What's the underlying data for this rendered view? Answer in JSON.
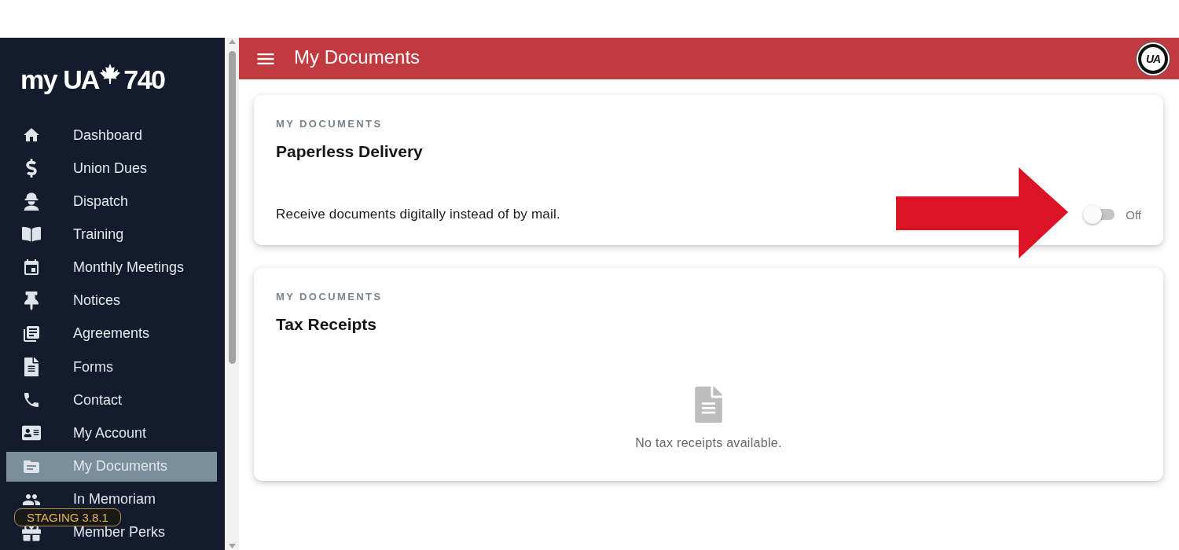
{
  "sidebar": {
    "logo": {
      "prefix": "my",
      "mark": "UA",
      "number": "740"
    },
    "items": [
      {
        "label": "Dashboard",
        "selected": false
      },
      {
        "label": "Union Dues",
        "selected": false
      },
      {
        "label": "Dispatch",
        "selected": false
      },
      {
        "label": "Training",
        "selected": false
      },
      {
        "label": "Monthly Meetings",
        "selected": false
      },
      {
        "label": "Notices",
        "selected": false
      },
      {
        "label": "Agreements",
        "selected": false
      },
      {
        "label": "Forms",
        "selected": false
      },
      {
        "label": "Contact",
        "selected": false
      },
      {
        "label": "My Account",
        "selected": false
      },
      {
        "label": "My Documents",
        "selected": true
      },
      {
        "label": "In Memoriam",
        "selected": false
      },
      {
        "label": "Member Perks",
        "selected": false
      }
    ],
    "staging_badge": "STAGING 3.8.1"
  },
  "header": {
    "title": "My Documents",
    "emblem": "UA"
  },
  "cards": [
    {
      "kind": "setting",
      "eyebrow": "MY DOCUMENTS",
      "title": "Paperless Delivery",
      "description": "Receive documents digitally instead of by mail.",
      "toggle": {
        "on": false,
        "label": "Off"
      }
    },
    {
      "kind": "empty",
      "eyebrow": "MY DOCUMENTS",
      "title": "Tax Receipts",
      "empty_message": "No tax receipts available."
    }
  ],
  "annotations": [
    {
      "kind": "arrow"
    }
  ]
}
